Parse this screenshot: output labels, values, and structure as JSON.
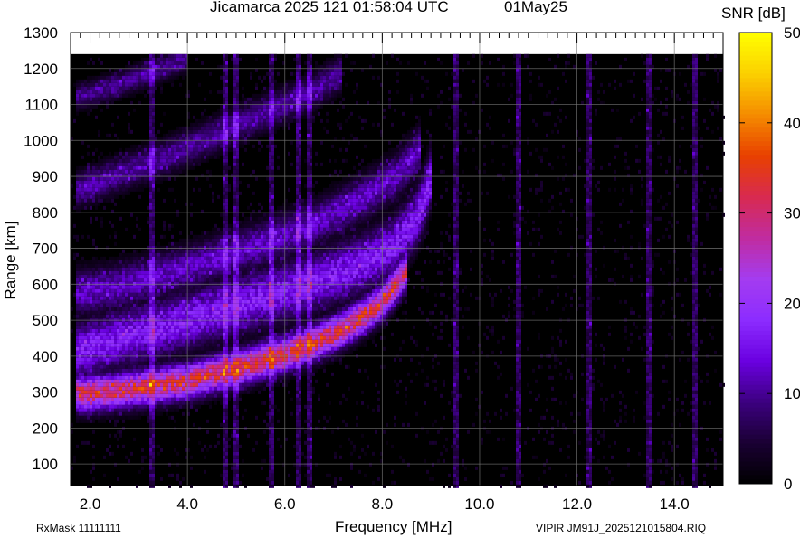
{
  "header": {
    "title": "Jicamarca 2025 121 01:58:04 UTC",
    "date": "01May25"
  },
  "footer": {
    "rxmask": "RxMask 11111111",
    "filename": "VIPIR  JM91J_2025121015804.RIQ"
  },
  "colorbar": {
    "title": "SNR [dB]",
    "range": [
      0,
      50
    ],
    "ticks": [
      "0",
      "10",
      "20",
      "30",
      "40",
      "50"
    ],
    "tick_values": [
      0,
      10,
      20,
      30,
      40,
      50
    ],
    "colormap": [
      "#000000",
      "#1a0033",
      "#3c0080",
      "#6a00e0",
      "#8c2cff",
      "#a43cf0",
      "#c02ca0",
      "#d82a50",
      "#e84000",
      "#f58c00",
      "#fbd000",
      "#ffff00"
    ]
  },
  "chart_data": {
    "type": "heatmap",
    "title": "Jicamarca 2025 121 01:58:04 UTC",
    "xlabel": "Frequency [MHz]",
    "ylabel": "Range [km]",
    "xlim": [
      1.6,
      15.0
    ],
    "ylim": [
      40,
      1300
    ],
    "data_top_km": 1240,
    "x_ticks": [
      2.0,
      4.0,
      6.0,
      8.0,
      10.0,
      12.0,
      14.0
    ],
    "x_tick_labels": [
      "2.0",
      "4.0",
      "6.0",
      "8.0",
      "10.0",
      "12.0",
      "14.0"
    ],
    "y_ticks": [
      100,
      200,
      300,
      400,
      500,
      600,
      700,
      800,
      900,
      1000,
      1100,
      1200,
      1300
    ],
    "y_tick_labels": [
      "100",
      "200",
      "300",
      "400",
      "500",
      "600",
      "700",
      "800",
      "900",
      "1000",
      "1100",
      "1200",
      "1300"
    ],
    "grid": true,
    "value_unit": "SNR [dB]",
    "echo_traces": [
      {
        "points": [
          [
            1.7,
            295
          ],
          [
            2.0,
            295
          ],
          [
            3.0,
            310
          ],
          [
            4.0,
            330
          ],
          [
            5.0,
            365
          ],
          [
            6.0,
            405
          ],
          [
            7.0,
            460
          ],
          [
            7.5,
            500
          ],
          [
            8.0,
            550
          ],
          [
            8.3,
            600
          ],
          [
            8.5,
            640
          ]
        ],
        "peak_snr": 32,
        "width_km": 55
      },
      {
        "points": [
          [
            1.7,
            410
          ],
          [
            2.5,
            445
          ],
          [
            3.5,
            480
          ],
          [
            4.5,
            520
          ],
          [
            5.5,
            560
          ],
          [
            6.5,
            600
          ],
          [
            7.5,
            650
          ],
          [
            8.2,
            700
          ],
          [
            8.7,
            780
          ],
          [
            8.9,
            850
          ],
          [
            9.0,
            900
          ]
        ],
        "peak_snr": 17,
        "width_km": 90
      },
      {
        "points": [
          [
            1.7,
            575
          ],
          [
            2.5,
            590
          ],
          [
            3.5,
            625
          ],
          [
            4.5,
            665
          ],
          [
            5.5,
            710
          ],
          [
            6.5,
            760
          ],
          [
            7.5,
            830
          ],
          [
            8.3,
            900
          ],
          [
            8.8,
            980
          ]
        ],
        "peak_snr": 13,
        "width_km": 70
      },
      {
        "points": [
          [
            1.7,
            860
          ],
          [
            2.5,
            900
          ],
          [
            3.5,
            950
          ],
          [
            4.5,
            1010
          ],
          [
            5.5,
            1070
          ],
          [
            6.5,
            1130
          ],
          [
            7.2,
            1190
          ]
        ],
        "peak_snr": 11,
        "width_km": 55
      },
      {
        "points": [
          [
            1.7,
            1120
          ],
          [
            2.5,
            1150
          ],
          [
            3.3,
            1190
          ],
          [
            4.0,
            1230
          ]
        ],
        "peak_snr": 10,
        "width_km": 40
      }
    ],
    "interference_lines_mhz": [
      3.3,
      4.8,
      5.0,
      5.75,
      6.3,
      6.5,
      9.5,
      10.8,
      12.25,
      13.45,
      14.45
    ]
  }
}
